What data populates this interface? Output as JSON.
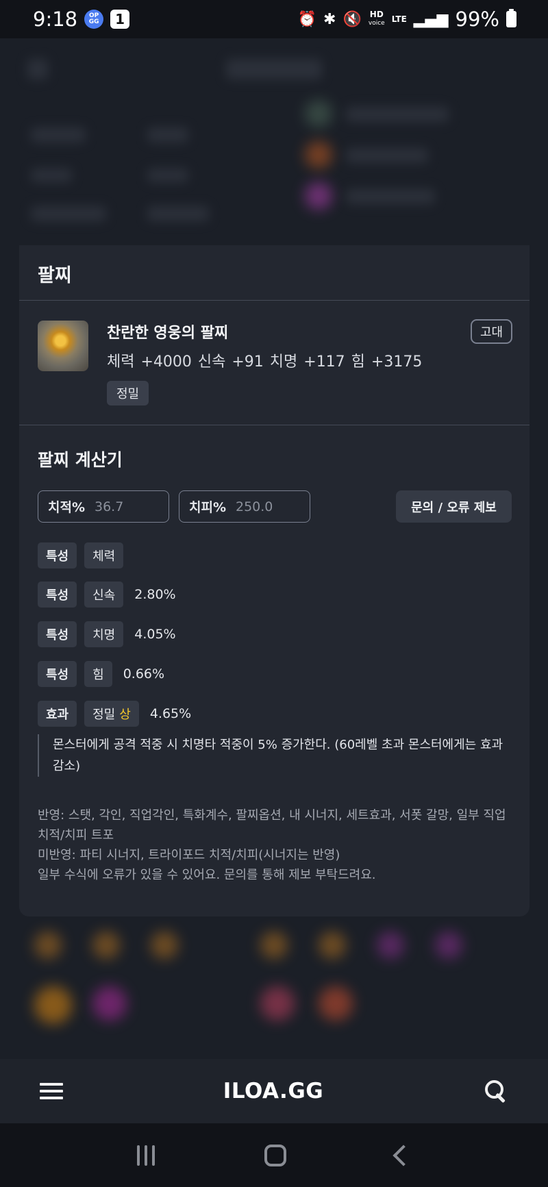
{
  "status_bar": {
    "time": "9:18",
    "notif_opgg": "OP GG",
    "notif_count": "1",
    "hd": "HD",
    "hd_sub": "voice",
    "lte": "LTE",
    "battery": "99%"
  },
  "panel": {
    "title": "팔찌",
    "item": {
      "name": "찬란한 영웅의 팔찌",
      "stats": "체력 +4000  신속 +91  치명 +117  힘 +3175",
      "tag": "정밀",
      "grade": "고대"
    }
  },
  "calculator": {
    "title": "팔찌 계산기",
    "crit_rate_label": "치적%",
    "crit_rate_value": "36.7",
    "crit_dmg_label": "치피%",
    "crit_dmg_value": "250.0",
    "report_button": "문의 / 오류 제보",
    "rows": [
      {
        "type": "특성",
        "stat": "체력",
        "value": ""
      },
      {
        "type": "특성",
        "stat": "신속",
        "value": "2.80%"
      },
      {
        "type": "특성",
        "stat": "치명",
        "value": "4.05%"
      },
      {
        "type": "특성",
        "stat": "힘",
        "value": "0.66%"
      }
    ],
    "effect_row": {
      "type": "효과",
      "stat": "정밀",
      "grade": "상",
      "value": "4.65%"
    },
    "effect_desc": "몬스터에게 공격 적중 시 치명타 적중이 5% 증가한다. (60레벨 초과 몬스터에게는 효과 감소)",
    "note_1": "반영: 스탯, 각인, 직업각인, 특화계수, 팔찌옵션, 내 시너지, 세트효과, 서폿 갈망, 일부 직업 치적/치피 트포",
    "note_2": "미반영: 파티 시너지, 트라이포드 치적/치피(시너지는 반영)",
    "note_3": "일부 수식에 오류가 있을 수 있어요. 문의를 통해 제보 부탁드려요."
  },
  "app_bar": {
    "logo": "ILOA.GG"
  },
  "colors": {
    "background": "#1a1d24",
    "panel": "#232730",
    "chip": "#353a45",
    "highlight": "#f3c62b"
  }
}
